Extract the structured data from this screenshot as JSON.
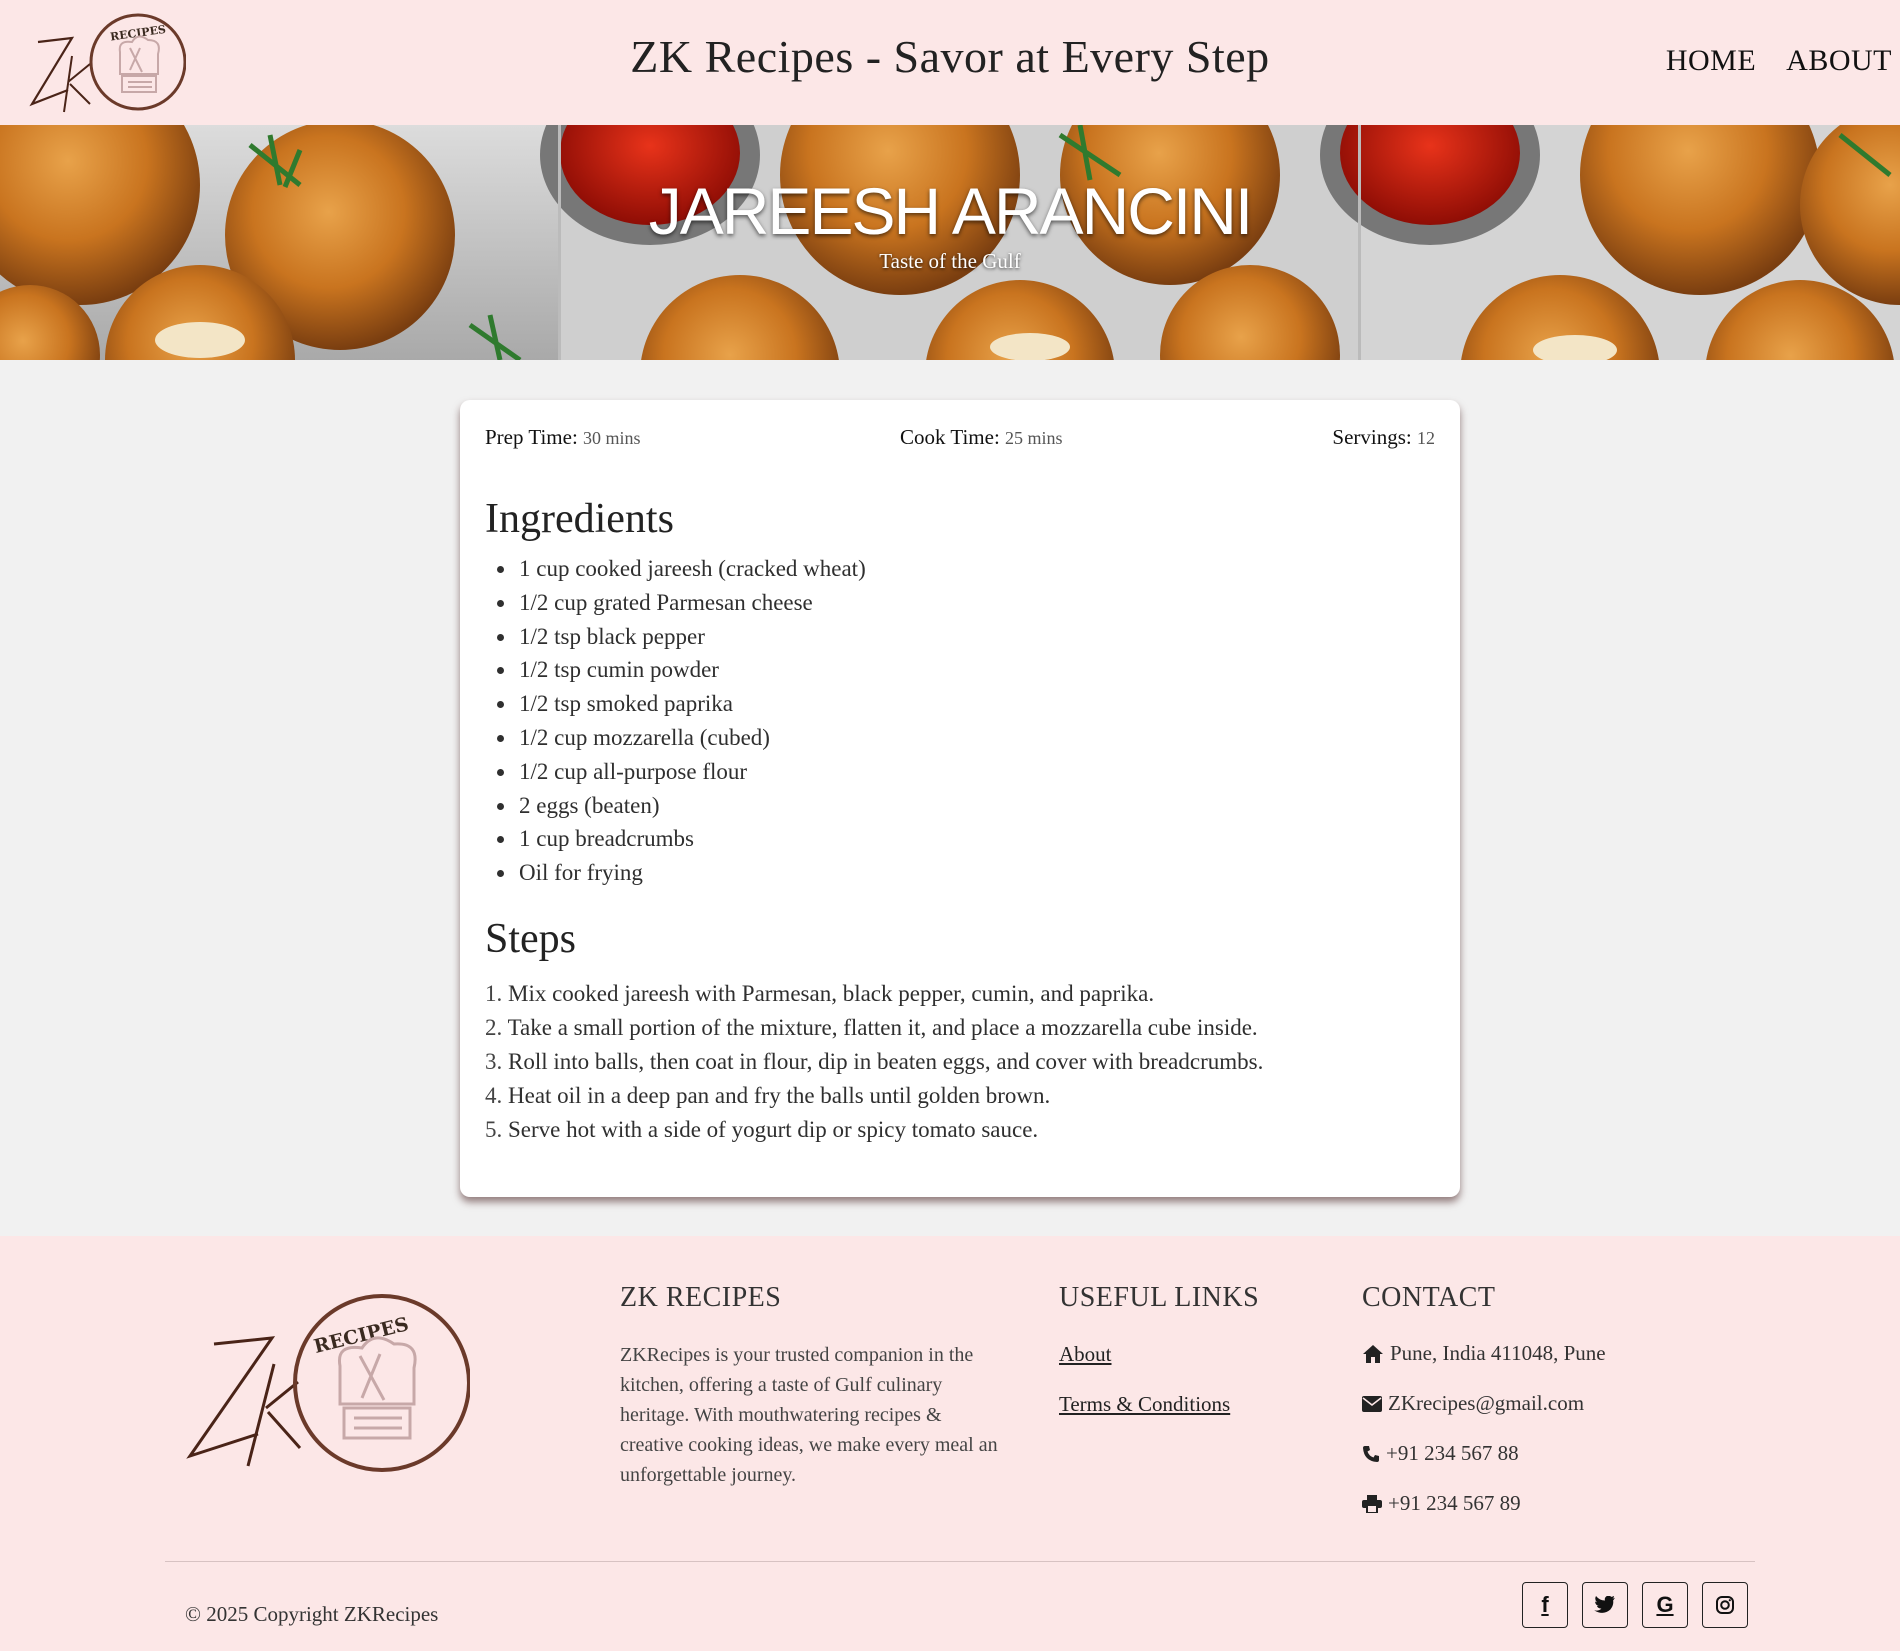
{
  "header": {
    "logo_text": "RECIPES",
    "title": "ZK Recipes - Savor at Every Step",
    "nav": [
      {
        "label": "HOME"
      },
      {
        "label": "ABOUT"
      }
    ]
  },
  "banner": {
    "title": "JAREESH ARANCINI",
    "subtitle": "Taste of the Gulf"
  },
  "recipe": {
    "prep_label": "Prep Time:",
    "prep_value": "30 mins",
    "cook_label": "Cook Time:",
    "cook_value": "25 mins",
    "servings_label": "Servings:",
    "servings_value": "12",
    "ingredients_heading": "Ingredients",
    "ingredients": [
      "1 cup cooked jareesh (cracked wheat)",
      "1/2 cup grated Parmesan cheese",
      "1/2 tsp black pepper",
      "1/2 tsp cumin powder",
      "1/2 tsp smoked paprika",
      "1/2 cup mozzarella (cubed)",
      "1/2 cup all-purpose flour",
      "2 eggs (beaten)",
      "1 cup breadcrumbs",
      "Oil for frying"
    ],
    "steps_heading": "Steps",
    "steps": [
      {
        "num": "1.",
        "text": "Mix cooked jareesh with Parmesan, black pepper, cumin, and paprika."
      },
      {
        "num": "2.",
        "text": "Take a small portion of the mixture, flatten it, and place a mozzarella cube inside."
      },
      {
        "num": "3.",
        "text": "Roll into balls, then coat in flour, dip in beaten eggs, and cover with breadcrumbs."
      },
      {
        "num": "4.",
        "text": "Heat oil in a deep pan and fry the balls until golden brown."
      },
      {
        "num": "5.",
        "text": "Serve hot with a side of yogurt dip or spicy tomato sauce."
      }
    ]
  },
  "footer": {
    "logo_text": "RECIPES",
    "about_heading": "ZK RECIPES",
    "about_text": "ZKRecipes is your trusted companion in the kitchen, offering a taste of Gulf culinary heritage. With mouthwatering recipes & creative cooking ideas, we make every meal an unforgettable journey.",
    "links_heading": "USEFUL LINKS",
    "links": [
      {
        "label": "About"
      },
      {
        "label": "Terms & Conditions"
      }
    ],
    "contact_heading": "CONTACT",
    "contact": {
      "address": "Pune, India 411048, Pune",
      "email": "ZKrecipes@gmail.com",
      "phone": "+91 234 567 88",
      "fax": "+91 234 567 89"
    },
    "copyright": "© 2025 Copyright ZKRecipes",
    "socials": [
      {
        "name": "facebook-icon",
        "glyph": "f"
      },
      {
        "name": "twitter-icon",
        "glyph": ""
      },
      {
        "name": "google-icon",
        "glyph": "G"
      },
      {
        "name": "instagram-icon",
        "glyph": ""
      }
    ]
  },
  "colors": {
    "header_bg": "#fce7e7",
    "page_bg": "#f1f1f1",
    "logo_brown": "#6b3a2a"
  }
}
